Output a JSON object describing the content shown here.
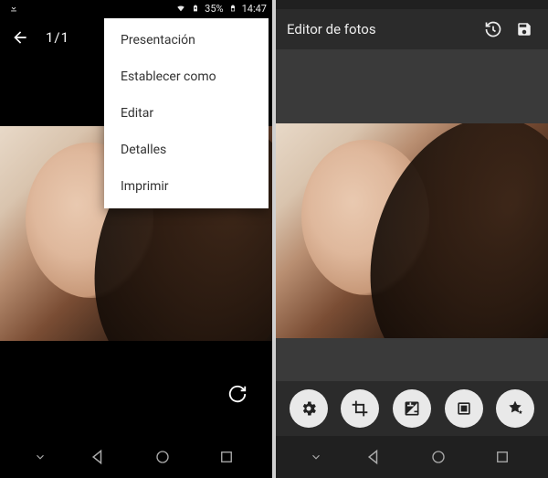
{
  "left": {
    "status": {
      "battery_pct": "35%",
      "time": "14:47"
    },
    "appbar": {
      "counter": "1/1"
    },
    "menu": {
      "items": [
        {
          "label": "Presentación"
        },
        {
          "label": "Establecer como"
        },
        {
          "label": "Editar"
        },
        {
          "label": "Detalles"
        },
        {
          "label": "Imprimir"
        }
      ]
    }
  },
  "right": {
    "appbar": {
      "title": "Editor de fotos"
    }
  }
}
